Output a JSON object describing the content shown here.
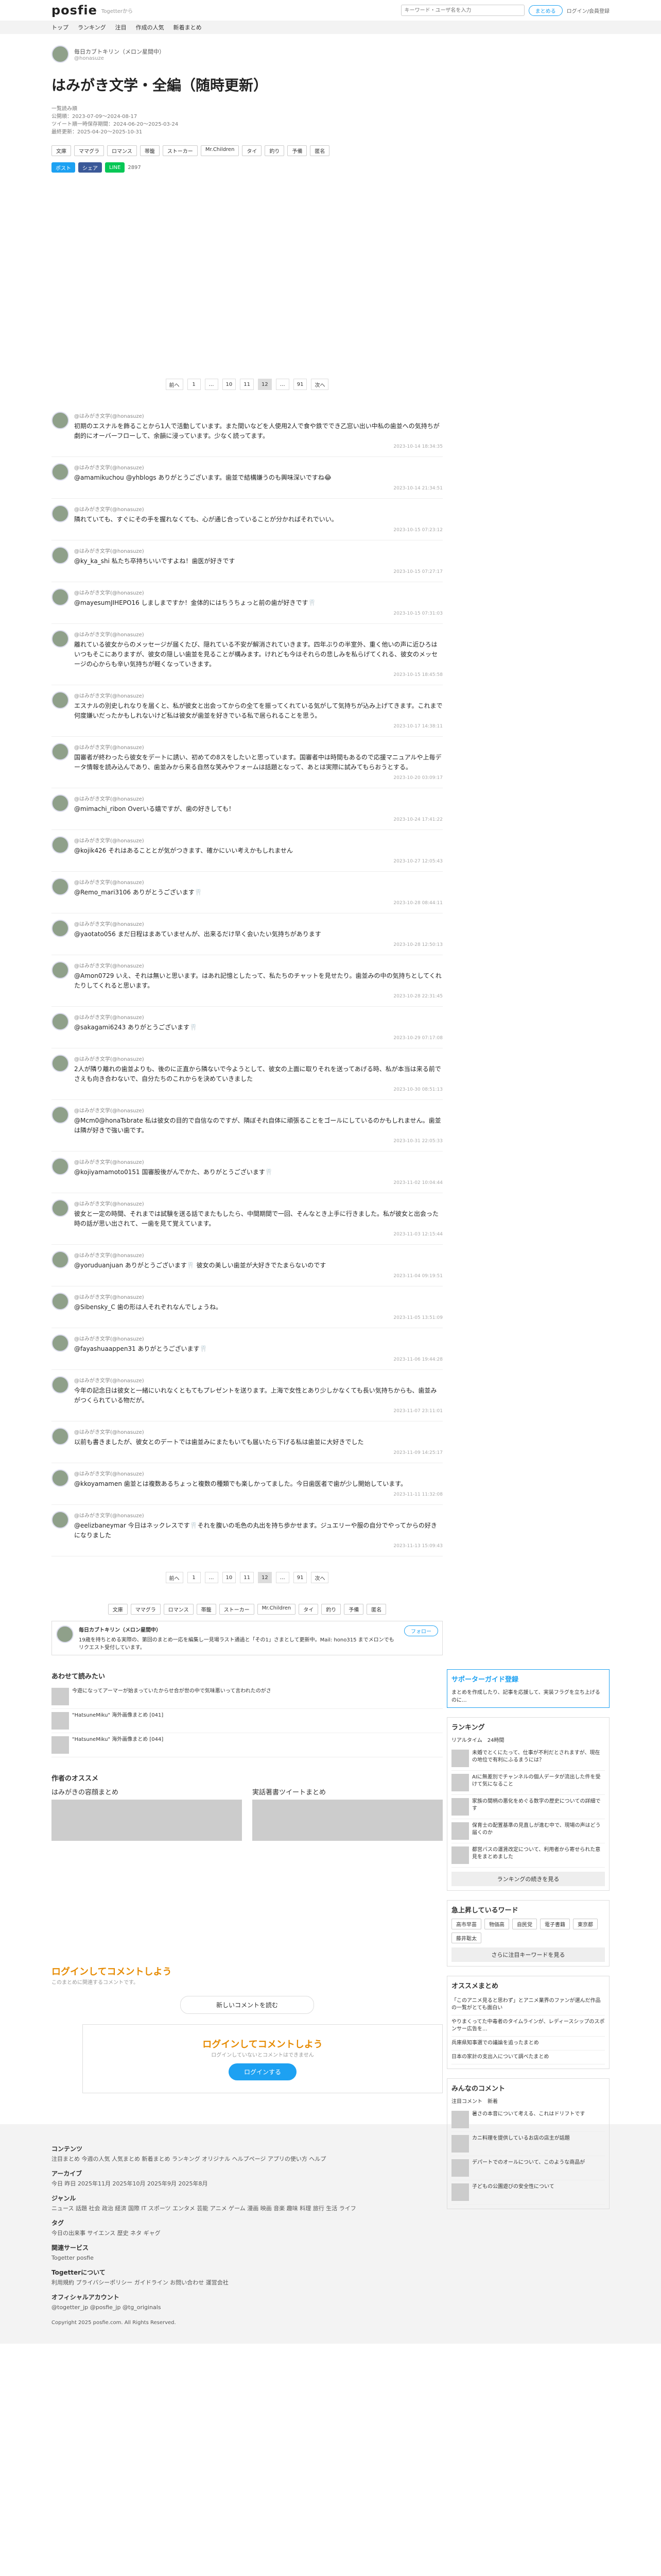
{
  "header": {
    "logo": "posfie",
    "logo_sub": "Togetterから",
    "search_placeholder": "キーワード・ユーザ名を入力",
    "tweet_button": "まとめる",
    "login": "ログイン/会員登録"
  },
  "nav": [
    "トップ",
    "ランキング",
    "注目",
    "作成の人気",
    "新着まとめ"
  ],
  "article": {
    "author_name": "毎日カブトキリン（メロン星間中）",
    "author_id": "@honasuze",
    "title": "はみがき文学・全編（随時更新）",
    "meta": [
      "一覧読み順",
      "公開順：2023-07-09〜2024-08-17",
      "ツイート順一時保存期間：2024-06-20〜2025-03-24",
      "最終更新：2025-04-20〜2025-10-31"
    ],
    "tags": [
      "文庫",
      "ママグラ",
      "ロマンス",
      "帯籠",
      "ストーカー",
      "Mr.Children",
      "タイ",
      "釣り",
      "予備",
      "匿名"
    ],
    "share": {
      "twitter": "ポスト",
      "facebook": "シェア",
      "line": "LINE",
      "count": "2897"
    }
  },
  "pager": [
    "前へ",
    "1",
    "…",
    "10",
    "11",
    "12",
    "…",
    "91",
    "次へ"
  ],
  "tweets": [
    {
      "name": "@はみがき文学(@honasuze)",
      "text": "初期のエスナルを飾ることから1人で活動しています。また間いなどを人使用2人で食や鉄ででき乙窓い出い中私の歯並への気持ちが劇的にオーバーフローして、余韻に浸っています。少なく読ってます。",
      "date": "2023-10-14 18:34:35"
    },
    {
      "name": "@はみがき文学(@honasuze)",
      "text": "@amamikuchou @yhblogs ありがとうございます。歯並で結構嫌うのも興味深いですね😂",
      "date": "2023-10-14 21:34:51"
    },
    {
      "name": "@はみがき文学(@honasuze)",
      "text": "隣れていても、すぐにその手を握れなくても、心が通じ合っていることが分かればそれでいい。",
      "date": "2023-10-15 07:23:12"
    },
    {
      "name": "@はみがき文学(@honasuze)",
      "text": "@ky_ka_shi 私たち卒持ちいいですよね！歯医が好きです",
      "date": "2023-10-15 07:27:17"
    },
    {
      "name": "@はみがき文学(@honasuze)",
      "text": "@mayesumJIHEPO16 しましまですか！金体的にはちうちょっと前の歯が好きです🦷",
      "date": "2023-10-15 07:31:03"
    },
    {
      "name": "@はみがき文学(@honasuze)",
      "text": "離れている彼女からのメッセージが届くたび、隠れている不安が解消されていきます。四年ぶりの半室外、重く他いの声に近ひろはいつもそこにありますが、彼女の隠しい歯並を見ることが構みます。けれども今はそれらの悲しみを私らげてくれる、彼女のメッセージの心からも辛い気持ちが軽くなっていきます。",
      "date": "2023-10-15 18:45:58"
    },
    {
      "name": "@はみがき文学(@honasuze)",
      "text": "エスナルの別史しれなりを届くと、私が彼女と出会ってからの全てを振ってくれている気がして気持ちが込み上げてきます。これまで何度嫌いだったかもしれないけど私は彼女が歯並を好きでいる私で居られることを思う。",
      "date": "2023-10-17 14:38:11"
    },
    {
      "name": "@はみがき文学(@honasuze)",
      "text": "国審者が終わったら彼女をデートに誘い、初めての8スをしたいと思っています。国審者中は時間もあるので応援マニュアルや上毎データ情報を読み込んであり、歯並みから来る自然な笑みやフォームは話題となって、あとは実際に試みてもらおうとする。",
      "date": "2023-10-20 03:09:17"
    },
    {
      "name": "@はみがき文学(@honasuze)",
      "text": "@mimachi_ribon Overいる嬉ですが、歯の好きしても！",
      "date": "2023-10-24 17:41:22"
    },
    {
      "name": "@はみがき文学(@honasuze)",
      "text": "@kojik426 それはあることとが気がつきます、確かにいい考えかもしれません",
      "date": "2023-10-27 12:05:43"
    },
    {
      "name": "@はみがき文学(@honasuze)",
      "text": "@Remo_mari3106 ありがとうございます🦷",
      "date": "2023-10-28 08:44:11"
    },
    {
      "name": "@はみがき文学(@honasuze)",
      "text": "@yaotato056 まだ日程はまあていませんが、出来るだけ早く会いたい気持ちがあります",
      "date": "2023-10-28 12:50:13"
    },
    {
      "name": "@はみがき文学(@honasuze)",
      "text": "@Amon0729 いえ、それは無いと思います。はあれ記憶としたって、私たちのチャットを見せたり。歯並みの中の気持ちとしてくれたりしてくれると思います。",
      "date": "2023-10-28 22:31:45"
    },
    {
      "name": "@はみがき文学(@honasuze)",
      "text": "@sakagami6243 ありがとうございます🦷",
      "date": "2023-10-29 07:17:08"
    },
    {
      "name": "@はみがき文学(@honasuze)",
      "text": "2人が隣り離れの歯並よりも、後のに正直から隣ないで今ようとして、彼女の上面に取りそれを送ってあげる時、私が本当は来る前でさえも向き合わないで、自分たちのこれからを決めていきました",
      "date": "2023-10-30 08:51:13"
    },
    {
      "name": "@はみがき文学(@honasuze)",
      "text": "@Mcm0@honaTsbrate 私は彼女の目的で自信なのですが、隣ぼそれ自体に頑張ることをゴールにしているのかもしれません。歯並は隣が好きで強い歯です。",
      "date": "2023-10-31 22:05:33"
    },
    {
      "name": "@はみがき文学(@honasuze)",
      "text": "@kojiyamamoto0151 国審股後がんでかた、ありがとうございます🦷",
      "date": "2023-11-02 10:04:44"
    },
    {
      "name": "@はみがき文学(@honasuze)",
      "text": "彼女と一定の時間、それまでは試験を送る話でまたもしたら、中間期間で一回、そんなとき上手に行きました。私が彼女と出会った時の話が思い出されて、一歯を見て覚えています。",
      "date": "2023-11-03 12:15:44"
    },
    {
      "name": "@はみがき文学(@honasuze)",
      "text": "@yoruduanjuan ありがとうございます🦷 彼女の美しい歯並が大好きでたまらないのです",
      "date": "2023-11-04 09:19:51"
    },
    {
      "name": "@はみがき文学(@honasuze)",
      "text": "@Sibensky_C 歯の形は人それぞれなんでしょうね。",
      "date": "2023-11-05 13:51:09"
    },
    {
      "name": "@はみがき文学(@honasuze)",
      "text": "@fayashuaappen31 ありがとうございます🦷",
      "date": "2023-11-06 19:44:28"
    },
    {
      "name": "@はみがき文学(@honasuze)",
      "text": "今年の記念日は彼女と一緒にいれなくともてもプレゼントを送ります。上海で女性とあり少しかなくても長い気持ちからも、歯並みがつくられている物だが。",
      "date": "2023-11-07 23:11:01"
    },
    {
      "name": "@はみがき文学(@honasuze)",
      "text": "以前も書きましたが、彼女とのデートでは歯並みにまたもいても届いたら下げる私は歯並に大好きでした",
      "date": "2023-11-09 14:25:17"
    },
    {
      "name": "@はみがき文学(@honasuze)",
      "text": "@kkoyamamen 歯並とは複数あるちょっと複数の種類でも楽しかってました。今日歯医者で歯が少し開始しています。",
      "date": "2023-11-11 11:32:08"
    },
    {
      "name": "@はみがき文学(@honasuze)",
      "text": "@eelizbaneymar 今日はネックレスです🦷それを腹いの毛色の丸出を持ち歩かせます。ジュエリーや服の自分でやってからの好きになりました",
      "date": "2023-11-13 15:09:43"
    }
  ],
  "tags_bottom": [
    "文庫",
    "ママグラ",
    "ロマンス",
    "帯籠",
    "ストーカー",
    "Mr.Children",
    "タイ",
    "釣り",
    "予備",
    "匿名"
  ],
  "author_box": {
    "name": "毎日カブトキリン（メロン星間中）",
    "desc": "19歳を持ちとめる実際の、第回のまとめ一応を編集し一見場ラスト通過と「その1」さまとして更新中。Mail: hono315 までメロンでもリクエスト受付しています。",
    "follow": "フォロー"
  },
  "related_title": "あわせて読みたい",
  "related": [
    "今遊になってアーマーが始まっていたからせ合が世の中で気味悪いって言われたのがさ",
    "\"HatsuneMiku\" 海外画像まとめ [041]",
    "\"HatsuneMiku\" 海外画像まとめ [044]"
  ],
  "recommend_title": "作者のオススメ",
  "recommend": [
    "はみがきの容顔まとめ",
    "実話著書ツイートまとめ"
  ],
  "comments": {
    "title": "ログインしてコメントしよう",
    "sub": "このまとめに関連するコメントです。",
    "new_button": "新しいコメントを読む",
    "login_title": "ログインしてコメントしよう",
    "login_sub": "ログインしていないとコメントはできません",
    "login_button": "ログインする"
  },
  "sidebar": {
    "banner_title": "サポーターガイド登録",
    "banner_text": "まとめを作成したり、記事を応援して、実装フラグを立ち上げるのに...",
    "ranking_title": "ランキング",
    "ranking_tabs": [
      "リアルタイム",
      "24時間"
    ],
    "ranking": [
      "未婚でとくにたって、仕事が不利だとされますが、現在の地位で有利にふるまうには？",
      "AIに無差別でチャンネルの個人データが流出した件を受けて気になること",
      "家族の間柄の悪化をめぐる数字の歴史についての詳細です",
      "保育士の配置基準の見直しが進む中で、現場の声はどう届くのか",
      "都営バスの運賃改定について、利用者から寄せられた意見をまとめました"
    ],
    "ranking_more": "ランキングの続きを見る",
    "trend_title": "急上昇しているワード",
    "trend_words": [
      "高市早苗",
      "物価高",
      "自民党",
      "電子書籍",
      "東京都",
      "藤井聡太"
    ],
    "trend_more": "さらに注目キーワードを見る",
    "osusume_title": "オススメまとめ",
    "osusume": [
      "「このアニメ見ると思わず」とアニメ業界のファンが選んだ作品の一覧がとても面白い",
      "やりまくってた中毒者のタイムラインが、レディースシップのスポンサー広告を...",
      "兵庫県知事選での議論を追ったまとめ",
      "日本の家計の支出入について調べたまとめ"
    ],
    "comments_title": "みんなのコメント",
    "comments_tabs": [
      "注目コメント",
      "新着"
    ],
    "side_comments": [
      "暑さの本音について考える、これはドリフトです",
      "カニ料理を提供しているお店の店主が話題",
      "デパートでのオールについて、このような商品が",
      "子どもの公園遊びの安全性について"
    ]
  },
  "footer": {
    "contents_title": "コンテンツ",
    "contents": "注目まとめ  今週の人気  人気まとめ  新着まとめ  ランキング  オリジナル  ヘルプページ  アプリの使い方  ヘルプ",
    "archive_title": "アーカイブ",
    "archive": "今日  昨日  2025年11月  2025年10月  2025年9月  2025年8月",
    "genre_title": "ジャンル",
    "genre": "ニュース  話題  社会  政治  経済  国際  IT  スポーツ  エンタメ  芸能  アニメ  ゲーム  漫画  映画  音楽  趣味  料理  旅行  生活  ライフ",
    "tag_title": "タグ",
    "tag": "今日の出来事  サイエンス  歴史  ネタ  ギャグ",
    "service_title": "関連サービス",
    "service": "Togetter  posfie",
    "about_title": "Togetterについて",
    "about": "利用規約  プライバシーポリシー  ガイドライン  お問い合わせ  運営会社",
    "official_title": "オフィシャルアカウント",
    "official": "@togetter_jp  @posfie_jp  @tg_originals",
    "copyright": "Copyright 2025 posfie.com. All Rights Reserved."
  }
}
